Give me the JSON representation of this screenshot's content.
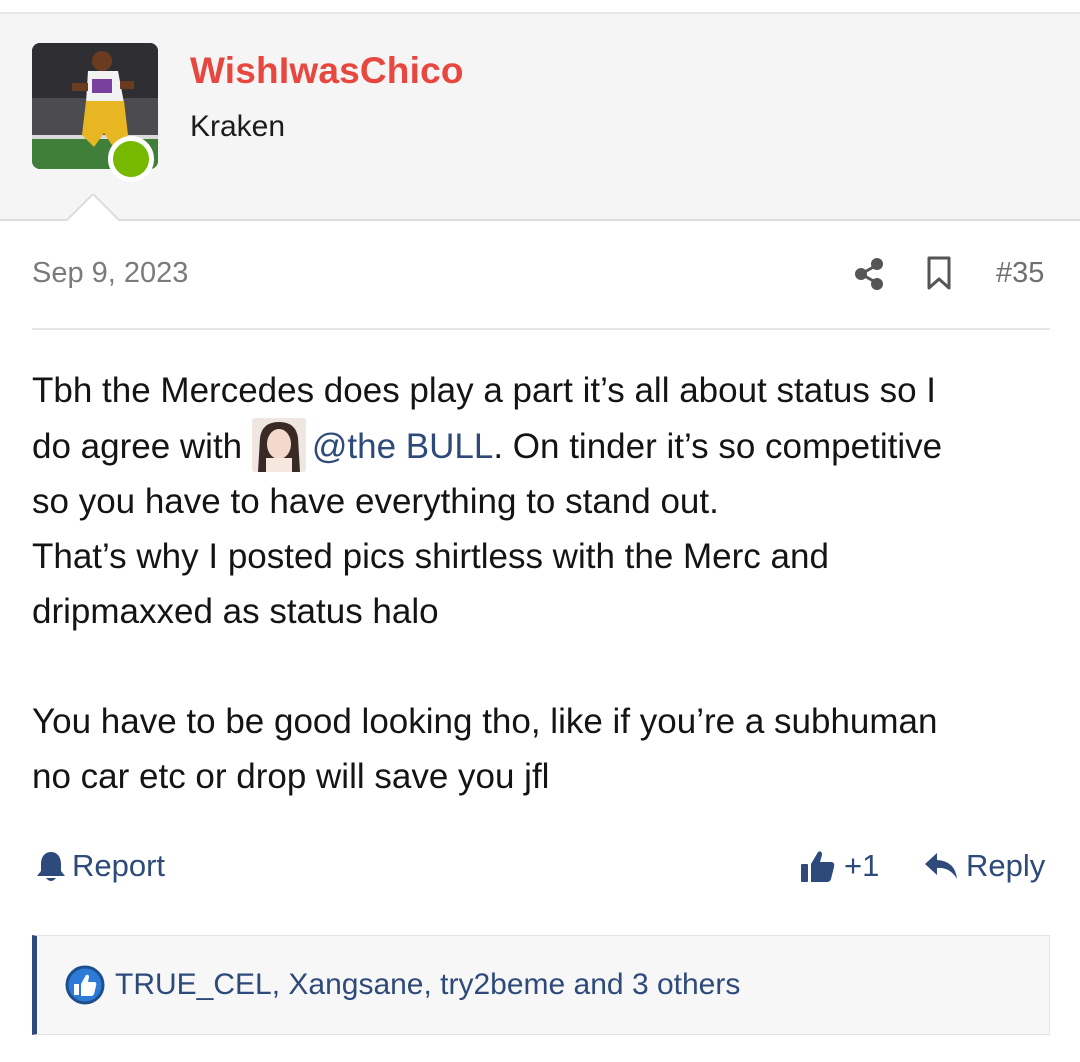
{
  "user": {
    "name": "WishIwasChico",
    "title": "Kraken",
    "online": true
  },
  "post": {
    "date": "Sep 9, 2023",
    "number": "#35",
    "line1": "Tbh the Mercedes does play a part it’s all about status so I",
    "line2_before": "do agree with",
    "mention": "@the BULL",
    "line2_after": ". On tinder it’s so competitive",
    "line3": "so you have to have everything to stand out.",
    "line4": "That’s why I posted pics shirtless with the Merc and",
    "line5": "dripmaxxed as status halo",
    "line6": "You have to be good looking tho, like if you’re a subhuman",
    "line7": "no car etc or drop will save you jfl"
  },
  "actions": {
    "report": "Report",
    "like_count": "+1",
    "reply": "Reply"
  },
  "reactions": {
    "text": "TRUE_CEL, Xangsane, try2beme and 3 others"
  },
  "colors": {
    "username": "#e8473f",
    "link": "#2d4a7a",
    "online": "#76b900"
  },
  "icons": [
    "share-icon",
    "bookmark-icon",
    "bell-icon",
    "thumbs-up-icon",
    "reply-arrow-icon",
    "like-reaction-icon"
  ]
}
